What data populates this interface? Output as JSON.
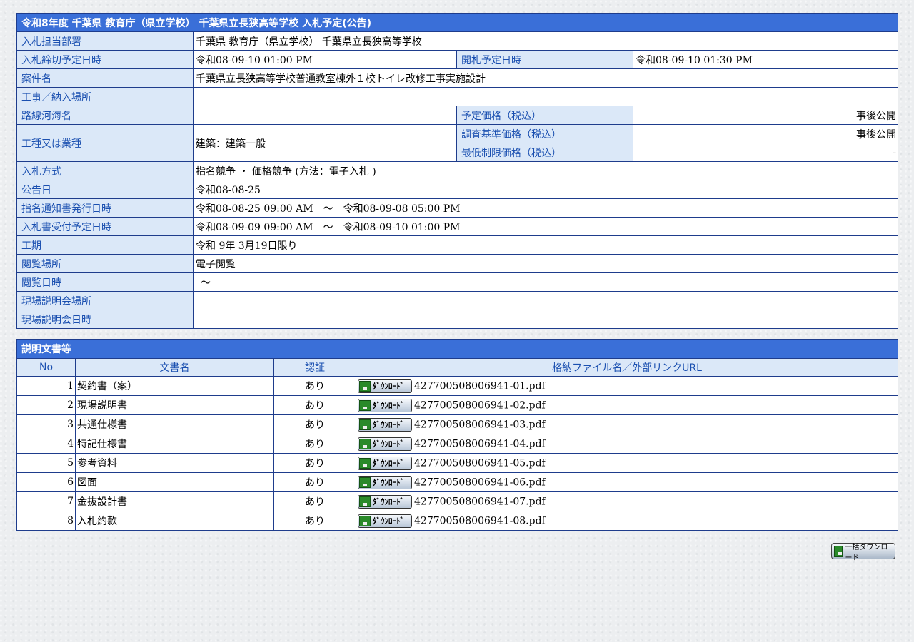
{
  "header": {
    "title": "令和8年度 千葉県 教育庁（県立学校） 千葉県立長狭高等学校 入札予定(公告)"
  },
  "fields": {
    "dept_label": "入札担当部署",
    "dept_value": "千葉県 教育庁（県立学校） 千葉県立長狭高等学校",
    "deadline_label": "入札締切予定日時",
    "deadline_value": "令和08-09-10 01:00 PM",
    "open_label": "開札予定日時",
    "open_value": "令和08-09-10 01:30 PM",
    "case_label": "案件名",
    "case_value": "千葉県立長狭高等学校普通教室棟外１校トイレ改修工事実施設計",
    "place_label": "工事／納入場所",
    "place_value": "",
    "route_label": "路線河海名",
    "route_value": "",
    "planned_price_label": "予定価格（税込）",
    "planned_price_value": "事後公開",
    "worktype_label": "工種又は業種",
    "worktype_value": "建築：建築一般",
    "survey_price_label": "調査基準価格（税込）",
    "survey_price_value": "事後公開",
    "min_price_label": "最低制限価格（税込）",
    "min_price_value": "-",
    "method_label": "入札方式",
    "method_value": "指名競争 ・ 価格競争 (方法：電子入札 )",
    "notice_label": "公告日",
    "notice_value": "令和08-08-25",
    "nomination_label": "指名通知書発行日時",
    "nomination_value": "令和08-08-25 09:00 AM　～　令和08-09-08 05:00 PM",
    "receipt_label": "入札書受付予定日時",
    "receipt_value": "令和08-09-09 09:00 AM　～　令和08-09-10 01:00 PM",
    "period_label": "工期",
    "period_value": "令和 9年 3月19日限り",
    "viewplace_label": "閲覧場所",
    "viewplace_value": "電子閲覧",
    "viewdate_label": "閲覧日時",
    "viewdate_value": "～",
    "site_place_label": "現場説明会場所",
    "site_place_value": "",
    "site_date_label": "現場説明会日時",
    "site_date_value": ""
  },
  "docs": {
    "title": "説明文書等",
    "columns": {
      "no": "No",
      "name": "文書名",
      "auth": "認証",
      "file": "格納ファイル名／外部リンクURL"
    },
    "download_label": "ﾀﾞｳﾝﾛｰﾄﾞ",
    "rows": [
      {
        "no": "1",
        "name": "契約書（案）",
        "auth": "あり",
        "file": "427700508006941-01.pdf"
      },
      {
        "no": "2",
        "name": "現場説明書",
        "auth": "あり",
        "file": "427700508006941-02.pdf"
      },
      {
        "no": "3",
        "name": "共通仕様書",
        "auth": "あり",
        "file": "427700508006941-03.pdf"
      },
      {
        "no": "4",
        "name": "特記仕様書",
        "auth": "あり",
        "file": "427700508006941-04.pdf"
      },
      {
        "no": "5",
        "name": "参考資料",
        "auth": "あり",
        "file": "427700508006941-05.pdf"
      },
      {
        "no": "6",
        "name": "図面",
        "auth": "あり",
        "file": "427700508006941-06.pdf"
      },
      {
        "no": "7",
        "name": "金抜設計書",
        "auth": "あり",
        "file": "427700508006941-07.pdf"
      },
      {
        "no": "8",
        "name": "入札約款",
        "auth": "あり",
        "file": "427700508006941-08.pdf"
      }
    ],
    "bulk_label": "一括ダウンロード"
  },
  "colors": {
    "header_bg": "#3a6fd8",
    "label_bg": "#dbe8f8",
    "label_text": "#1a4fb0",
    "border": "#1e3c8c"
  }
}
